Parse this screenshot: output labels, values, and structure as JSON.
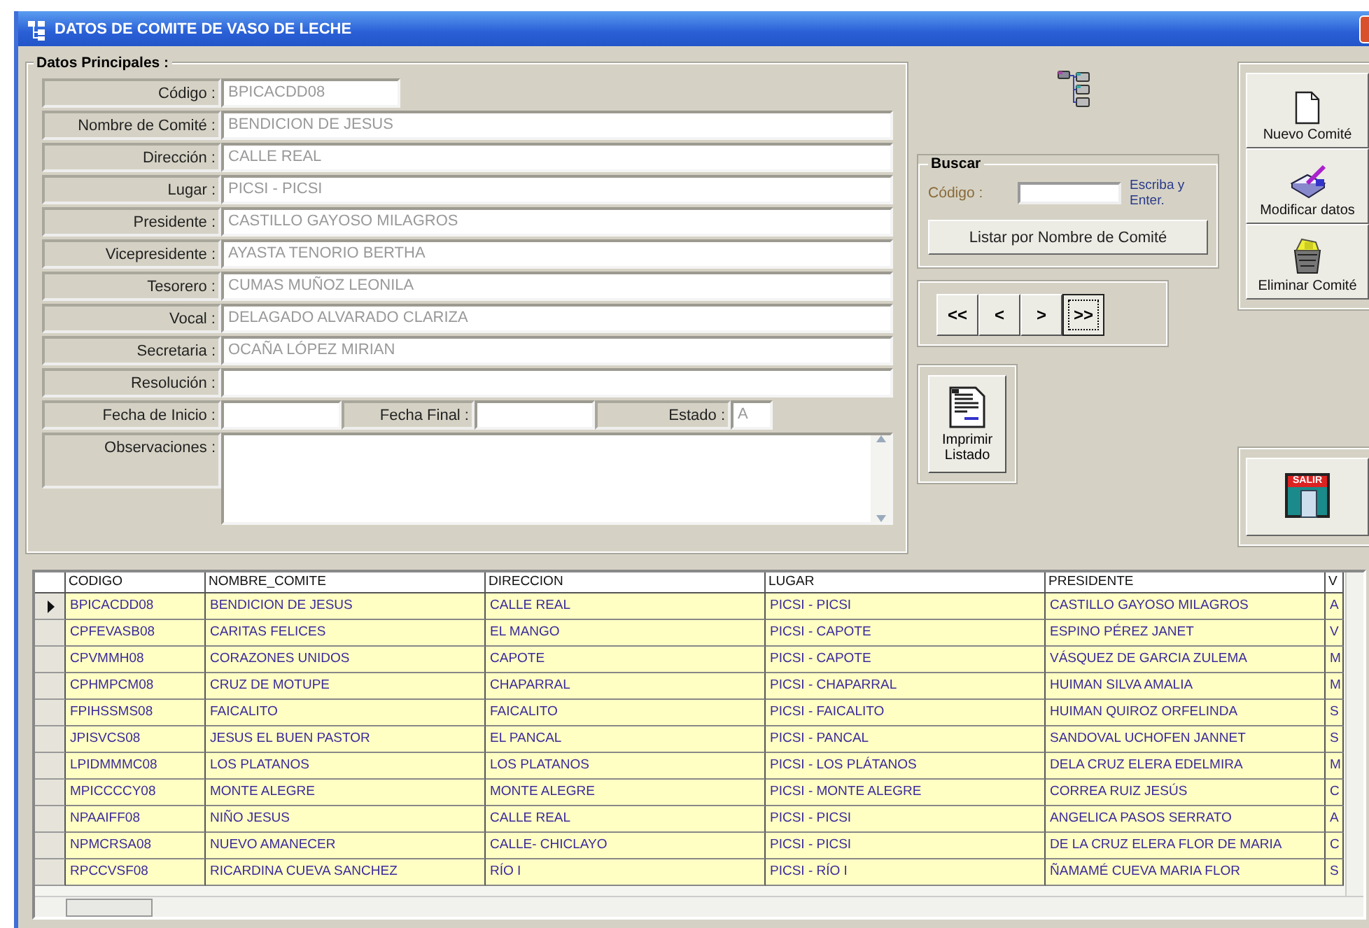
{
  "window": {
    "title": "DATOS DE COMITE DE VASO DE LECHE"
  },
  "form": {
    "legend": "Datos Principales :",
    "rows": [
      {
        "kind": "short",
        "label": "Código :",
        "value": "BPICACDD08"
      },
      {
        "kind": "wide",
        "label": "Nombre de Comité :",
        "value": "BENDICION DE JESUS"
      },
      {
        "kind": "wide",
        "label": "Dirección :",
        "value": "CALLE REAL"
      },
      {
        "kind": "wide",
        "label": "Lugar :",
        "value": "PICSI - PICSI"
      },
      {
        "kind": "wide",
        "label": "Presidente :",
        "value": "CASTILLO GAYOSO MILAGROS"
      },
      {
        "kind": "wide",
        "label": "Vicepresidente :",
        "value": "AYASTA TENORIO BERTHA"
      },
      {
        "kind": "wide",
        "label": "Tesorero :",
        "value": "CUMAS MUÑOZ LEONILA"
      },
      {
        "kind": "wide",
        "label": "Vocal :",
        "value": "DELAGADO ALVARADO CLARIZA"
      },
      {
        "kind": "wide",
        "label": "Secretaria :",
        "value": "OCAÑA LÓPEZ MIRIAN"
      },
      {
        "kind": "wide",
        "label": "Resolución :"
      },
      {
        "kind": "triple",
        "items": [
          {
            "label": "Fecha de Inicio :"
          },
          {
            "label": "Fecha Final :"
          },
          {
            "label": "Estado :",
            "value": "A"
          }
        ]
      },
      {
        "kind": "memo",
        "label": "Observaciones :"
      }
    ]
  },
  "search": {
    "legend": "Buscar",
    "label": "Código :",
    "hint": "Escriba y Enter.",
    "button": "Listar por Nombre de Comité"
  },
  "navigation": [
    {
      "label": "<<",
      "focused": false
    },
    {
      "label": "<",
      "focused": false
    },
    {
      "label": ">",
      "focused": false
    },
    {
      "label": ">>",
      "focused": true
    }
  ],
  "actions": [
    {
      "kind": "new",
      "label": "Nuevo Comité"
    },
    {
      "kind": "edit",
      "label": "Modificar datos"
    },
    {
      "kind": "delete",
      "label": "Eliminar Comité"
    }
  ],
  "print": {
    "label": "Imprimir Listado"
  },
  "exit": {
    "sign": "SALIR"
  },
  "grid": {
    "columns": [
      "CODIGO",
      "NOMBRE_COMITE",
      "DIRECCION",
      "LUGAR",
      "PRESIDENTE",
      "V"
    ],
    "rows": [
      {
        "selected": true,
        "cells": [
          "BPICACDD08",
          "BENDICION DE JESUS",
          "CALLE REAL",
          "PICSI - PICSI",
          "CASTILLO GAYOSO MILAGROS",
          "A"
        ]
      },
      {
        "selected": false,
        "cells": [
          "CPFEVASB08",
          "CARITAS FELICES",
          "EL MANGO",
          "PICSI - CAPOTE",
          "ESPINO PÉREZ JANET",
          "V"
        ]
      },
      {
        "selected": false,
        "cells": [
          "CPVMMH08",
          "CORAZONES UNIDOS",
          "CAPOTE",
          "PICSI - CAPOTE",
          "VÁSQUEZ DE GARCIA ZULEMA",
          "M"
        ]
      },
      {
        "selected": false,
        "cells": [
          "CPHMPCM08",
          "CRUZ DE MOTUPE",
          "CHAPARRAL",
          "PICSI - CHAPARRAL",
          "HUIMAN SILVA AMALIA",
          "M"
        ]
      },
      {
        "selected": false,
        "cells": [
          "FPIHSSMS08",
          "FAICALITO",
          "FAICALITO",
          "PICSI - FAICALITO",
          "HUIMAN QUIROZ ORFELINDA",
          "S"
        ]
      },
      {
        "selected": false,
        "cells": [
          "JPISVCS08",
          "JESUS EL BUEN PASTOR",
          "EL PANCAL",
          "PICSI - PANCAL",
          "SANDOVAL UCHOFEN JANNET",
          "S"
        ]
      },
      {
        "selected": false,
        "cells": [
          "LPIDMMMC08",
          "LOS PLATANOS",
          "LOS PLATANOS",
          "PICSI - LOS PLÁTANOS",
          "DELA CRUZ ELERA EDELMIRA",
          "M"
        ]
      },
      {
        "selected": false,
        "cells": [
          "MPICCCCY08",
          "MONTE ALEGRE",
          "MONTE ALEGRE",
          "PICSI - MONTE ALEGRE",
          "CORREA RUIZ JESÚS",
          "C"
        ]
      },
      {
        "selected": false,
        "cells": [
          "NPAAIFF08",
          "NIÑO JESUS",
          "CALLE REAL",
          "PICSI - PICSI",
          "ANGELICA PASOS SERRATO",
          "A"
        ]
      },
      {
        "selected": false,
        "cells": [
          "NPMCRSA08",
          "NUEVO AMANECER",
          "CALLE- CHICLAYO",
          "PICSI - PICSI",
          "DE LA CRUZ ELERA FLOR DE MARIA",
          "C"
        ]
      },
      {
        "selected": false,
        "cells": [
          "RPCCVSF08",
          "RICARDINA CUEVA SANCHEZ",
          "RÍO I",
          "PICSI - RÍO I",
          "ÑAMAMÉ CUEVA MARIA FLOR",
          "S"
        ]
      }
    ]
  }
}
